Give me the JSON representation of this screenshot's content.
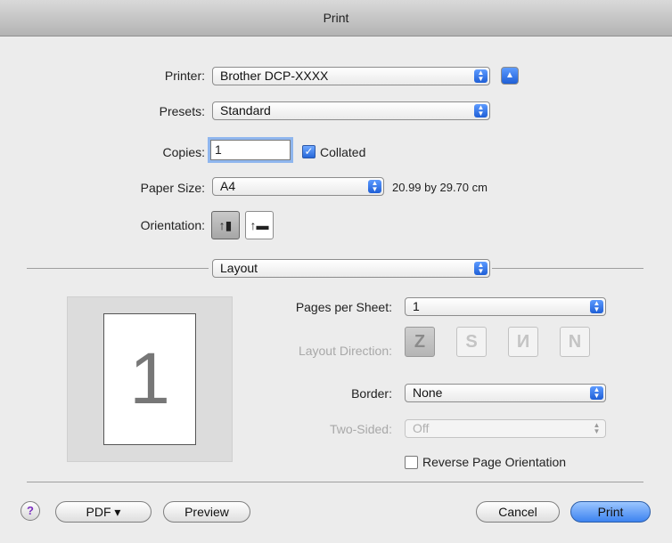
{
  "window": {
    "title": "Print"
  },
  "printer": {
    "label": "Printer:",
    "value": "Brother DCP-XXXX"
  },
  "presets": {
    "label": "Presets:",
    "value": "Standard"
  },
  "copies": {
    "label": "Copies:",
    "value": "1",
    "collated_label": "Collated",
    "collated": true
  },
  "paper_size": {
    "label": "Paper Size:",
    "value": "A4",
    "dimensions": "20.99 by 29.70 cm"
  },
  "orientation": {
    "label": "Orientation:",
    "selected": "portrait"
  },
  "section": {
    "value": "Layout"
  },
  "preview": {
    "page_number": "1"
  },
  "layout": {
    "pages_per_sheet_label": "Pages per Sheet:",
    "pages_per_sheet_value": "1",
    "layout_direction_label": "Layout Direction:",
    "border_label": "Border:",
    "border_value": "None",
    "two_sided_label": "Two-Sided:",
    "two_sided_value": "Off",
    "reverse_label": "Reverse Page Orientation",
    "reverse_checked": false
  },
  "footer": {
    "help": "?",
    "pdf_label": "PDF ▾",
    "preview_label": "Preview",
    "cancel_label": "Cancel",
    "print_label": "Print"
  },
  "icons": {
    "popup_arrows": "up-down-arrows-icon",
    "disclosure": "triangle-up-icon",
    "portrait": "portrait-orientation-icon",
    "landscape": "landscape-orientation-icon"
  }
}
